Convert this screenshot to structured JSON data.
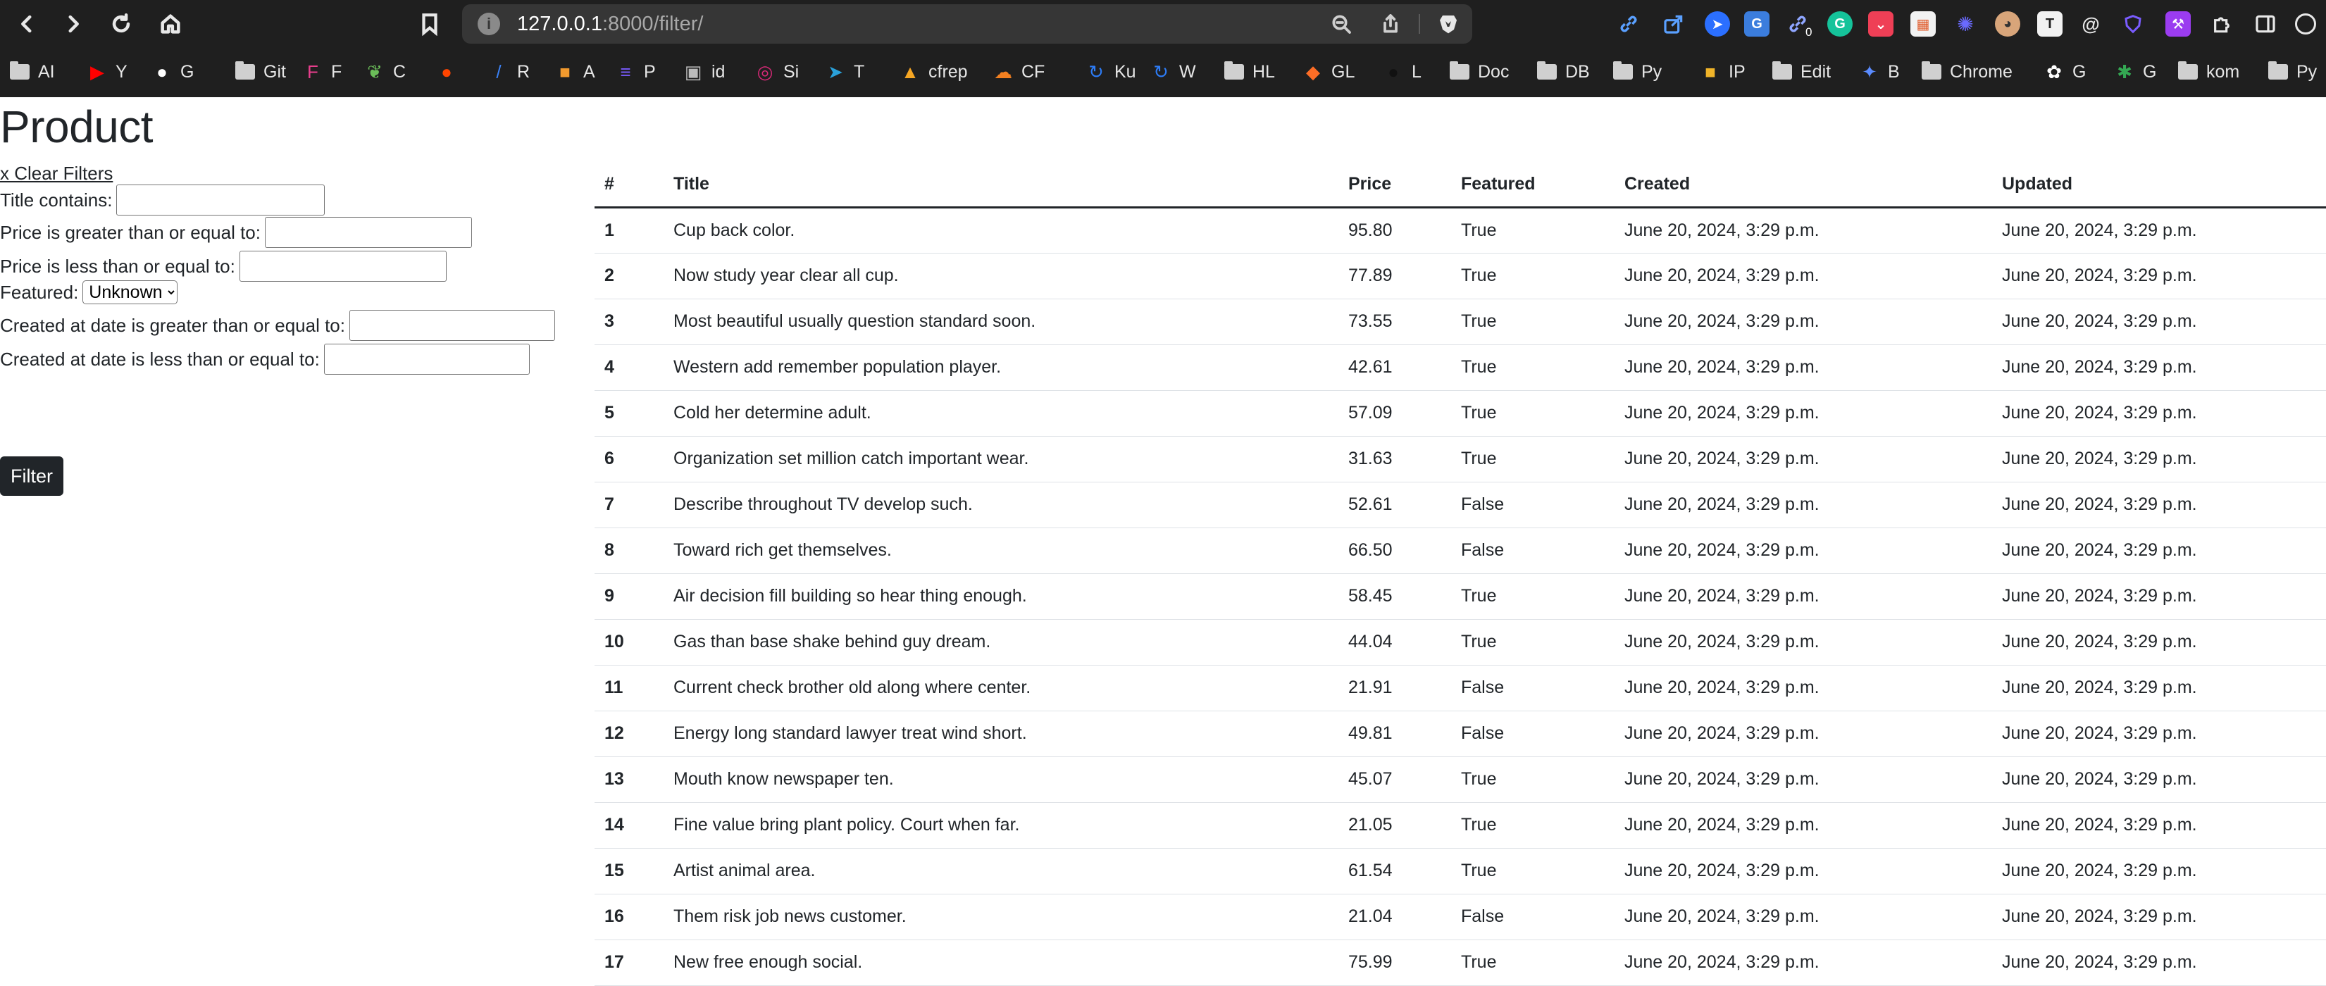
{
  "browser": {
    "url_host": "127.0.0.1",
    "url_rest": ":8000/filter/",
    "extension_badge": "0",
    "bookmarks": [
      {
        "label": "AI",
        "icon": "folder-icon"
      },
      {
        "label": "Y",
        "icon": "youtube-icon"
      },
      {
        "label": "G",
        "icon": "github-icon"
      },
      {
        "label": "Git",
        "icon": "folder-icon"
      },
      {
        "label": "F",
        "icon": "f-badge-icon"
      },
      {
        "label": "C",
        "icon": "leaf-icon"
      },
      {
        "label": "",
        "icon": "reddit-icon"
      },
      {
        "label": "R",
        "icon": "r-slash-icon"
      },
      {
        "label": "A",
        "icon": "cube-icon"
      },
      {
        "label": "P",
        "icon": "list-icon"
      },
      {
        "label": "id",
        "icon": "bus-icon"
      },
      {
        "label": "Si",
        "icon": "instagram-icon"
      },
      {
        "label": "T",
        "icon": "telegram-icon"
      },
      {
        "label": "cfrep",
        "icon": "flame-icon"
      },
      {
        "label": "CF",
        "icon": "cloud-icon"
      },
      {
        "label": "Ku",
        "icon": "loop-icon"
      },
      {
        "label": "W",
        "icon": "loop-icon"
      },
      {
        "label": "HL",
        "icon": "folder-icon"
      },
      {
        "label": "GL",
        "icon": "gitlab-icon"
      },
      {
        "label": "L",
        "icon": "dark-circle-icon"
      },
      {
        "label": "Doc",
        "icon": "folder-icon"
      },
      {
        "label": "DB",
        "icon": "folder-icon"
      },
      {
        "label": "Py",
        "icon": "folder-icon"
      },
      {
        "label": "IP",
        "icon": "box-icon"
      },
      {
        "label": "Edit",
        "icon": "folder-icon"
      },
      {
        "label": "B",
        "icon": "sparkle-icon"
      },
      {
        "label": "Chrome",
        "icon": "folder-icon"
      },
      {
        "label": "G",
        "icon": "openai-icon"
      },
      {
        "label": "G",
        "icon": "photos-icon"
      },
      {
        "label": "kom",
        "icon": "folder-icon"
      },
      {
        "label": "Py",
        "icon": "folder-icon"
      }
    ]
  },
  "page": {
    "title": "Product",
    "clear_filters": "x Clear Filters",
    "filters": {
      "title_contains": "Title contains:",
      "price_gte": "Price is greater than or equal to:",
      "price_lte": "Price is less than or equal to:",
      "featured": "Featured:",
      "featured_value": "Unknown",
      "created_gte": "Created at date is greater than or equal to:",
      "created_lte": "Created at date is less than or equal to:"
    },
    "filter_button": "Filter"
  },
  "table": {
    "headers": [
      "#",
      "Title",
      "Price",
      "Featured",
      "Created",
      "Updated"
    ],
    "rows": [
      [
        "1",
        "Cup back color.",
        "95.80",
        "True",
        "June 20, 2024, 3:29 p.m.",
        "June 20, 2024, 3:29 p.m."
      ],
      [
        "2",
        "Now study year clear all cup.",
        "77.89",
        "True",
        "June 20, 2024, 3:29 p.m.",
        "June 20, 2024, 3:29 p.m."
      ],
      [
        "3",
        "Most beautiful usually question standard soon.",
        "73.55",
        "True",
        "June 20, 2024, 3:29 p.m.",
        "June 20, 2024, 3:29 p.m."
      ],
      [
        "4",
        "Western add remember population player.",
        "42.61",
        "True",
        "June 20, 2024, 3:29 p.m.",
        "June 20, 2024, 3:29 p.m."
      ],
      [
        "5",
        "Cold her determine adult.",
        "57.09",
        "True",
        "June 20, 2024, 3:29 p.m.",
        "June 20, 2024, 3:29 p.m."
      ],
      [
        "6",
        "Organization set million catch important wear.",
        "31.63",
        "True",
        "June 20, 2024, 3:29 p.m.",
        "June 20, 2024, 3:29 p.m."
      ],
      [
        "7",
        "Describe throughout TV develop such.",
        "52.61",
        "False",
        "June 20, 2024, 3:29 p.m.",
        "June 20, 2024, 3:29 p.m."
      ],
      [
        "8",
        "Toward rich get themselves.",
        "66.50",
        "False",
        "June 20, 2024, 3:29 p.m.",
        "June 20, 2024, 3:29 p.m."
      ],
      [
        "9",
        "Air decision fill building so hear thing enough.",
        "58.45",
        "True",
        "June 20, 2024, 3:29 p.m.",
        "June 20, 2024, 3:29 p.m."
      ],
      [
        "10",
        "Gas than base shake behind guy dream.",
        "44.04",
        "True",
        "June 20, 2024, 3:29 p.m.",
        "June 20, 2024, 3:29 p.m."
      ],
      [
        "11",
        "Current check brother old along where center.",
        "21.91",
        "False",
        "June 20, 2024, 3:29 p.m.",
        "June 20, 2024, 3:29 p.m."
      ],
      [
        "12",
        "Energy long standard lawyer treat wind short.",
        "49.81",
        "False",
        "June 20, 2024, 3:29 p.m.",
        "June 20, 2024, 3:29 p.m."
      ],
      [
        "13",
        "Mouth know newspaper ten.",
        "45.07",
        "True",
        "June 20, 2024, 3:29 p.m.",
        "June 20, 2024, 3:29 p.m."
      ],
      [
        "14",
        "Fine value bring plant policy. Court when far.",
        "21.05",
        "True",
        "June 20, 2024, 3:29 p.m.",
        "June 20, 2024, 3:29 p.m."
      ],
      [
        "15",
        "Artist animal area.",
        "61.54",
        "True",
        "June 20, 2024, 3:29 p.m.",
        "June 20, 2024, 3:29 p.m."
      ],
      [
        "16",
        "Them risk job news customer.",
        "21.04",
        "False",
        "June 20, 2024, 3:29 p.m.",
        "June 20, 2024, 3:29 p.m."
      ],
      [
        "17",
        "New free enough social.",
        "75.99",
        "True",
        "June 20, 2024, 3:29 p.m.",
        "June 20, 2024, 3:29 p.m."
      ]
    ]
  }
}
